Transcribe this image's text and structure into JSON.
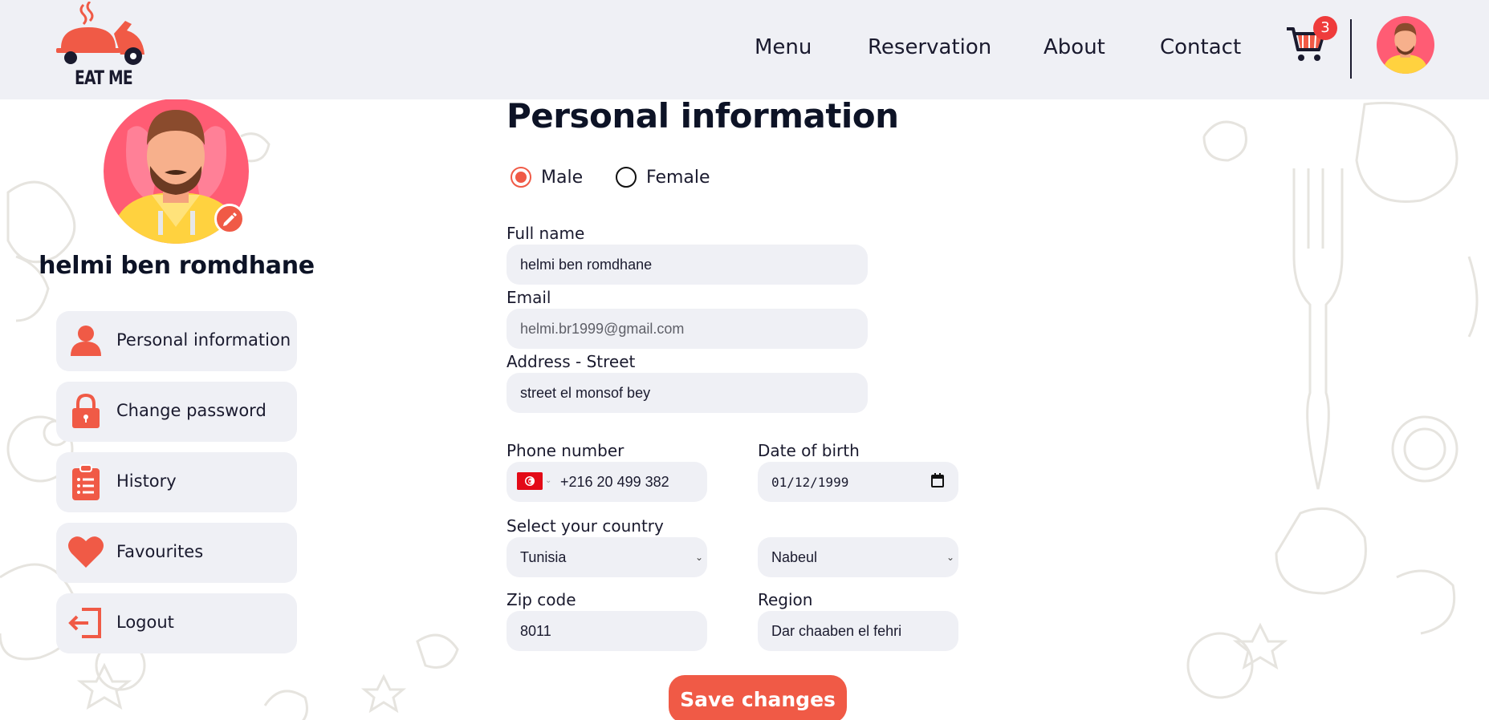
{
  "brand": {
    "name": "EAT ME"
  },
  "nav": {
    "items": [
      {
        "label": "Menu"
      },
      {
        "label": "Reservation"
      },
      {
        "label": "About"
      },
      {
        "label": "Contact"
      }
    ],
    "cart_count": "3"
  },
  "profile": {
    "name": "helmi ben romdhane"
  },
  "sidebar": {
    "items": [
      {
        "label": "Personal information",
        "icon": "user-icon"
      },
      {
        "label": "Change password",
        "icon": "lock-icon"
      },
      {
        "label": "History",
        "icon": "clipboard-list-icon"
      },
      {
        "label": "Favourites",
        "icon": "heart-icon"
      },
      {
        "label": "Logout",
        "icon": "logout-icon"
      }
    ]
  },
  "form": {
    "title": "Personal information",
    "gender": {
      "male": "Male",
      "female": "Female",
      "selected": "Male"
    },
    "full_name": {
      "label": "Full name",
      "value": "helmi ben romdhane"
    },
    "email": {
      "label": "Email",
      "value": "helmi.br1999@gmail.com"
    },
    "address": {
      "label": "Address - Street",
      "value": "street el monsof bey"
    },
    "phone": {
      "label": "Phone number",
      "value": "+216 20 499 382",
      "country_flag": "tunisia-flag-icon"
    },
    "dob": {
      "label": "Date of birth",
      "value": "01/12/1999"
    },
    "country": {
      "label": "Select your country",
      "value": "Tunisia"
    },
    "state": {
      "value": "Nabeul"
    },
    "zip": {
      "label": "Zip code",
      "value": "8011"
    },
    "region": {
      "label": "Region",
      "value": "Dar chaaben el fehri"
    },
    "save_label": "Save changes"
  },
  "colors": {
    "accent": "#f05a46",
    "panel": "#eff0f5",
    "text": "#1a1a2e",
    "badge": "#ef3b3b"
  }
}
